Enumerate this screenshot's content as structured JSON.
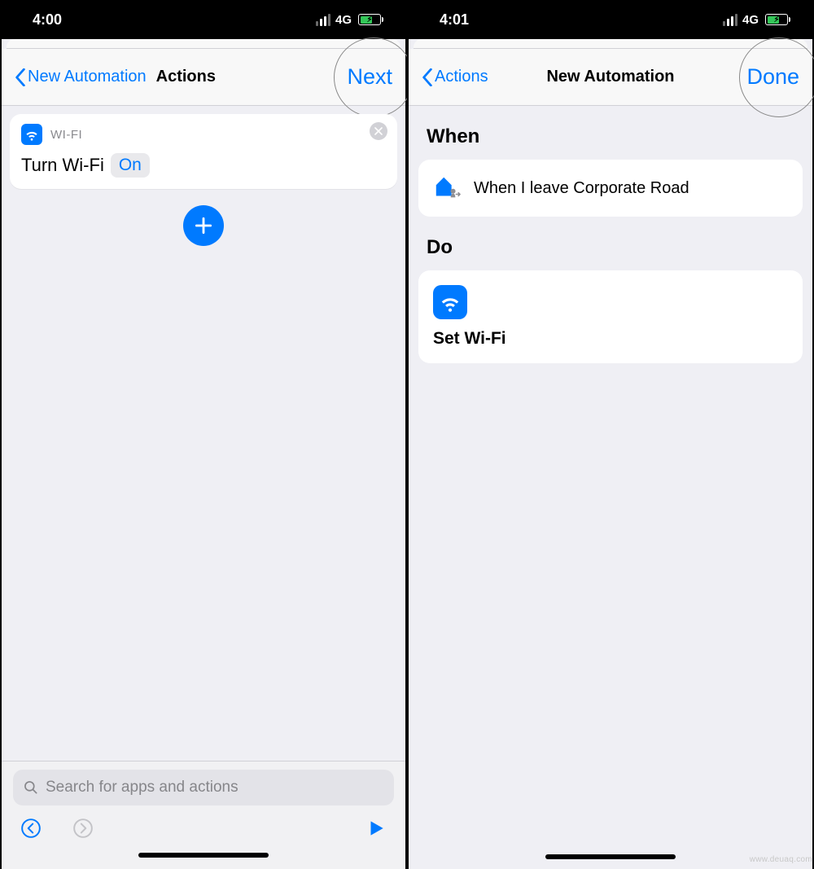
{
  "left": {
    "status": {
      "time": "4:00",
      "network": "4G"
    },
    "nav": {
      "back": "New Automation",
      "title": "Actions",
      "action": "Next"
    },
    "card": {
      "category": "WI-FI",
      "text": "Turn Wi-Fi",
      "param": "On"
    },
    "search": {
      "placeholder": "Search for apps and actions"
    }
  },
  "right": {
    "status": {
      "time": "4:01",
      "network": "4G"
    },
    "nav": {
      "back": "Actions",
      "title": "New Automation",
      "action": "Done"
    },
    "when": {
      "header": "When",
      "text": "When I leave Corporate Road"
    },
    "do": {
      "header": "Do",
      "text": "Set Wi-Fi"
    }
  },
  "watermark": "www.deuaq.com"
}
